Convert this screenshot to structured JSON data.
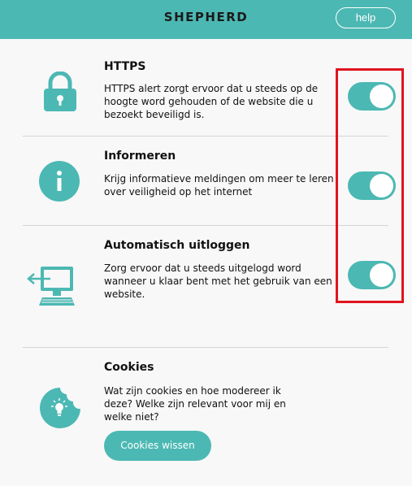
{
  "header": {
    "logo": "SHEPHERD",
    "help_label": "help"
  },
  "colors": {
    "accent": "#4cb8b3",
    "highlight": "#e0141e"
  },
  "settings": [
    {
      "title": "HTTPS",
      "icon": "lock-icon",
      "description": [
        "HTTPS alert zorgt ervoor dat u steeds op de",
        "hoogte word gehouden of de website die u",
        "bezoekt beveiligd is."
      ],
      "enabled": true
    },
    {
      "title": "Informeren",
      "icon": "info-icon",
      "description": [
        "Krijg informatieve meldingen om meer te leren",
        "over veiligheid op het internet"
      ],
      "enabled": true
    },
    {
      "title": "Automatisch uitloggen",
      "icon": "logout-computer-icon",
      "description": [
        "Zorg ervoor dat u steeds uitgelogd word",
        "wanneer u klaar bent met het gebruik van een",
        "website."
      ],
      "enabled": true
    }
  ],
  "cookies": {
    "title": "Cookies",
    "icon": "cookie-icon",
    "description": [
      "Wat zijn cookies en hoe modereer ik",
      "deze? Welke zijn relevant voor mij en",
      "welke niet?"
    ],
    "button_label": "Cookies wissen"
  }
}
